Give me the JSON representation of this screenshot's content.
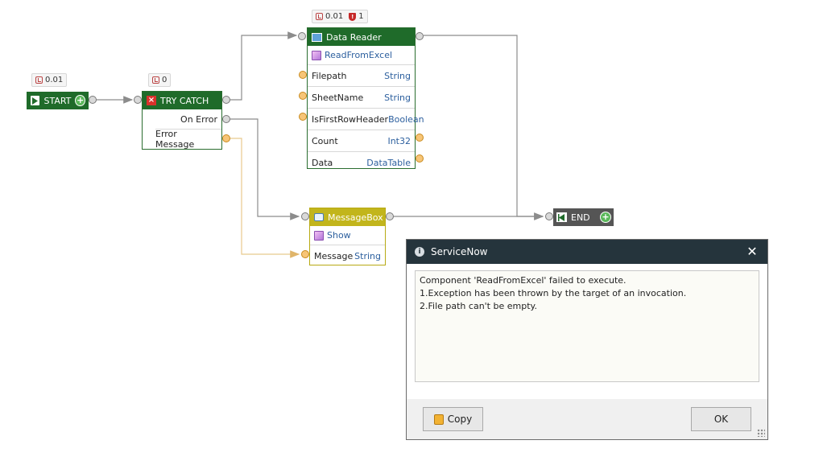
{
  "nodes": {
    "start": {
      "label": "START",
      "timing": "0.01"
    },
    "try_catch": {
      "label": "TRY CATCH",
      "timing": "0",
      "outputs": [
        "On Error",
        "Error Message"
      ]
    },
    "data_reader": {
      "label": "Data Reader",
      "timing": "0.01",
      "errors": "1",
      "method": "ReadFromExcel",
      "params": [
        {
          "name": "Filepath",
          "type": "String"
        },
        {
          "name": "SheetName",
          "type": "String"
        },
        {
          "name": "IsFirstRowHeader",
          "type": "Boolean"
        },
        {
          "name": "Count",
          "type": "Int32"
        },
        {
          "name": "Data",
          "type": "DataTable"
        }
      ]
    },
    "message_box": {
      "label": "MessageBox",
      "method": "Show",
      "params": [
        {
          "name": "Message",
          "type": "String"
        }
      ]
    },
    "end": {
      "label": "END"
    }
  },
  "dialog": {
    "title": "ServiceNow",
    "message": "Component 'ReadFromExcel' failed to execute.\n1.Exception has been thrown by the target of an invocation.\n2.File path can't be empty.",
    "copy_label": "Copy",
    "ok_label": "OK"
  },
  "colors": {
    "node_green": "#1f6b2a",
    "node_yellow": "#c2b51c",
    "wire_gray": "#8c8c8c",
    "wire_orange": "#e8c98e",
    "dialog_title": "#25343c"
  },
  "icons": [
    "timer-icon",
    "error-shield-icon",
    "play-icon",
    "add-icon",
    "close-icon",
    "method-icon",
    "info-icon",
    "clipboard-icon",
    "message-icon",
    "end-icon"
  ]
}
